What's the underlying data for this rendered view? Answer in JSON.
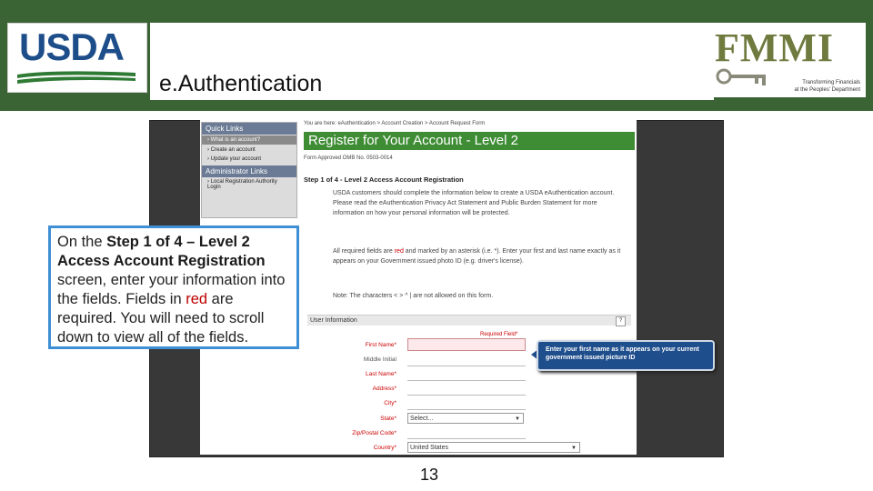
{
  "header": {
    "title": "e.Authentication",
    "usda_logo": "USDA",
    "fmmi_logo": "FMMI",
    "fmmi_tagline_1": "Transforming Financials",
    "fmmi_tagline_2": "at the Peoples' Department",
    "band_color": "#3a6433"
  },
  "sidebar": {
    "quick_links_title": "Quick Links",
    "items": [
      {
        "label": "What is an account?"
      },
      {
        "label": "Create an account"
      },
      {
        "label": "Update your account"
      }
    ],
    "admin_title": "Administrator Links",
    "admin_items": [
      {
        "label": "Local Registration Authority Login"
      }
    ]
  },
  "form": {
    "breadcrumb": "You are here: eAuthentication > Account Creation > Account Request Form",
    "heading": "Register for Your Account - Level 2",
    "form_approved": "Form Approved OMB No. 0503-0014",
    "step": "Step 1 of 4 - Level 2 Access Account Registration",
    "intro": "USDA customers should complete the information below to create a USDA eAuthentication account. Please read the eAuthentication Privacy Act Statement and Public Burden Statement for more information on how your personal information will be protected.",
    "required_part1": "All required fields are",
    "required_red": "red",
    "required_part2": "and marked by an asterisk (i.e. *). Enter your first and last name exactly as it appears on your Government issued photo ID (e.g. driver's license).",
    "note": "Note: The characters < > ^ | are not allowed on this form.",
    "section": "User Information",
    "help": "?",
    "required_field": "Required Field*",
    "fields": {
      "first_name": "First Name*",
      "middle_initial": "Middle Initial",
      "last_name": "Last Name*",
      "address": "Address*",
      "city": "City*",
      "state": "State*",
      "zip": "Zip/Postal Code*",
      "country": "Country*"
    },
    "state_value": "Select...",
    "country_value": "United States",
    "accent": "#3e8c34"
  },
  "tooltip": {
    "text": "Enter your first name as it appears on your current government issued picture ID"
  },
  "callout": {
    "t1": "On the ",
    "b1": "Step 1 of 4 – Level 2 Access Account Registration",
    "t2": " screen, enter your information into the fields. Fields in ",
    "red": "red",
    "t3": " are required. You will need to scroll down to view all of the fields.",
    "border_color": "#3f8fd4"
  },
  "footer": {
    "page_number": "13"
  }
}
